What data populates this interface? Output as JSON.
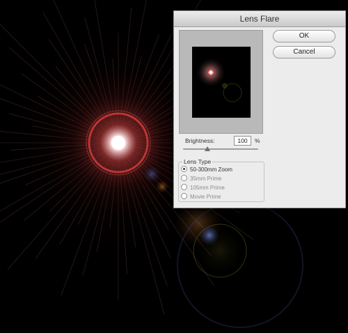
{
  "dialog": {
    "title": "Lens Flare",
    "ok_label": "OK",
    "cancel_label": "Cancel",
    "brightness_label": "Brightness:",
    "brightness_value": "100",
    "brightness_unit": "%",
    "lens_type_label": "Lens Type",
    "lens_types": [
      {
        "label": "50-300mm Zoom",
        "selected": true
      },
      {
        "label": "35mm Prime",
        "selected": false
      },
      {
        "label": "105mm Prime",
        "selected": false
      },
      {
        "label": "Movie Prime",
        "selected": false
      }
    ]
  }
}
